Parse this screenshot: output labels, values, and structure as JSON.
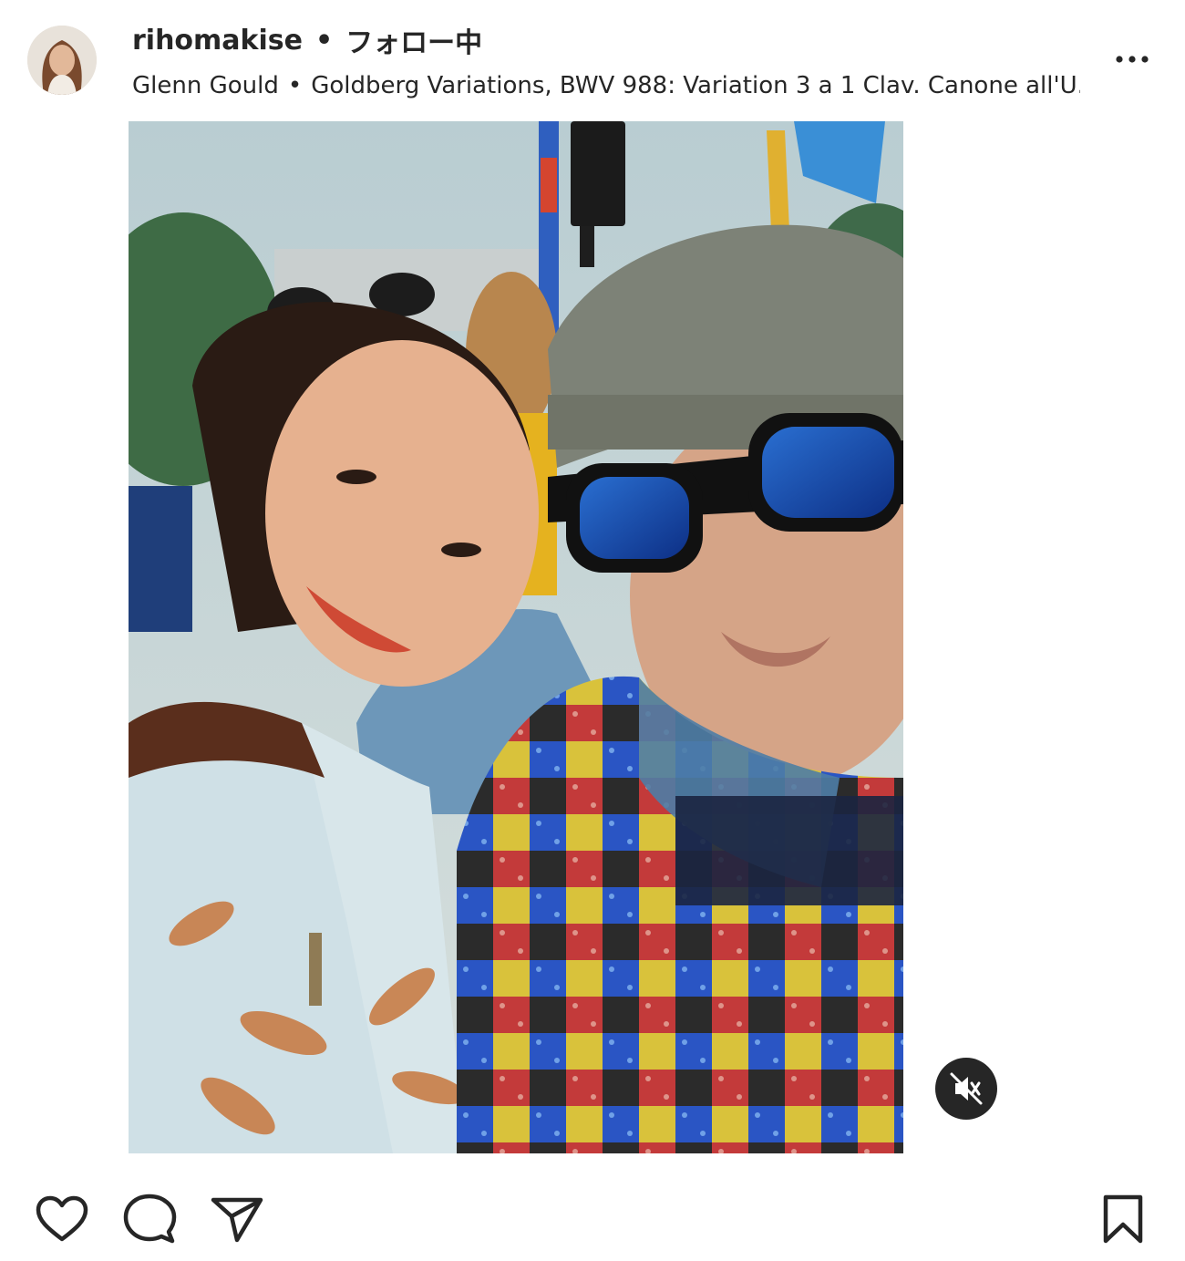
{
  "post": {
    "username": "rihomakise",
    "separator": "•",
    "follow_status": "フォロー中",
    "audio": {
      "artist": "Glenn Gould",
      "separator": "•",
      "track": "Goldberg Variations, BWV 988: Variation 3 a 1 Clav. Canone all'U..."
    }
  },
  "icons": {
    "more": "more-options-icon",
    "mute": "muted-speaker-icon",
    "like": "heart-icon",
    "comment": "comment-bubble-icon",
    "share": "paper-plane-icon",
    "save": "bookmark-icon"
  },
  "colors": {
    "text": "#262626",
    "background": "#ffffff",
    "mute_button_bg": "#262626"
  }
}
